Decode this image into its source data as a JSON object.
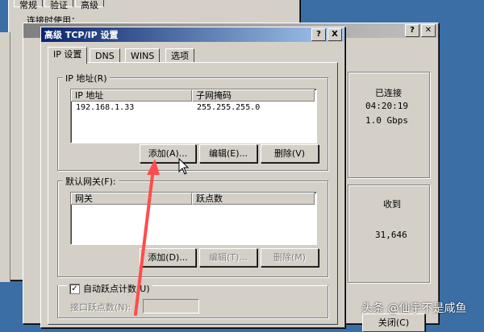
{
  "background_window_1": {
    "tabs": [
      "常规",
      "验证",
      "高级"
    ],
    "label_connect": "连接时使用："
  },
  "background_window_2": {
    "status_connected": "已连接",
    "duration": "04:20:19",
    "speed": "1.0 Gbps",
    "received_label": "收到",
    "received_value": "31,646",
    "close_label": "关闭(C)"
  },
  "dialog": {
    "title": "高级 TCP/IP 设置",
    "help_btn": "?",
    "close_btn": "X",
    "tabs": [
      "IP 设置",
      "DNS",
      "WINS",
      "选项"
    ],
    "ip_group": {
      "label": "IP 地址(R)",
      "headers": [
        "IP 地址",
        "子网掩码"
      ],
      "rows": [
        {
          "ip": "192.168.1.33",
          "mask": "255.255.255.0"
        }
      ],
      "add": "添加(A)...",
      "edit": "编辑(E)...",
      "delete": "删除(V)"
    },
    "gw_group": {
      "label": "默认网关(F):",
      "headers": [
        "网关",
        "跃点数"
      ],
      "add": "添加(D)...",
      "edit": "编辑(T)...",
      "delete": "删除(M)"
    },
    "auto_metric": {
      "checked": true,
      "label": "自动跃点计数(U)"
    },
    "interface_metric_label": "接口跃点数(N):",
    "interface_metric_value": ""
  },
  "watermark": "头条 @仙宇不是咸鱼",
  "colors": {
    "desktop": "#3a6ea5",
    "titlebar": "#0a246a",
    "face": "#d4d0c8",
    "arrow": "#ff4d4d"
  }
}
